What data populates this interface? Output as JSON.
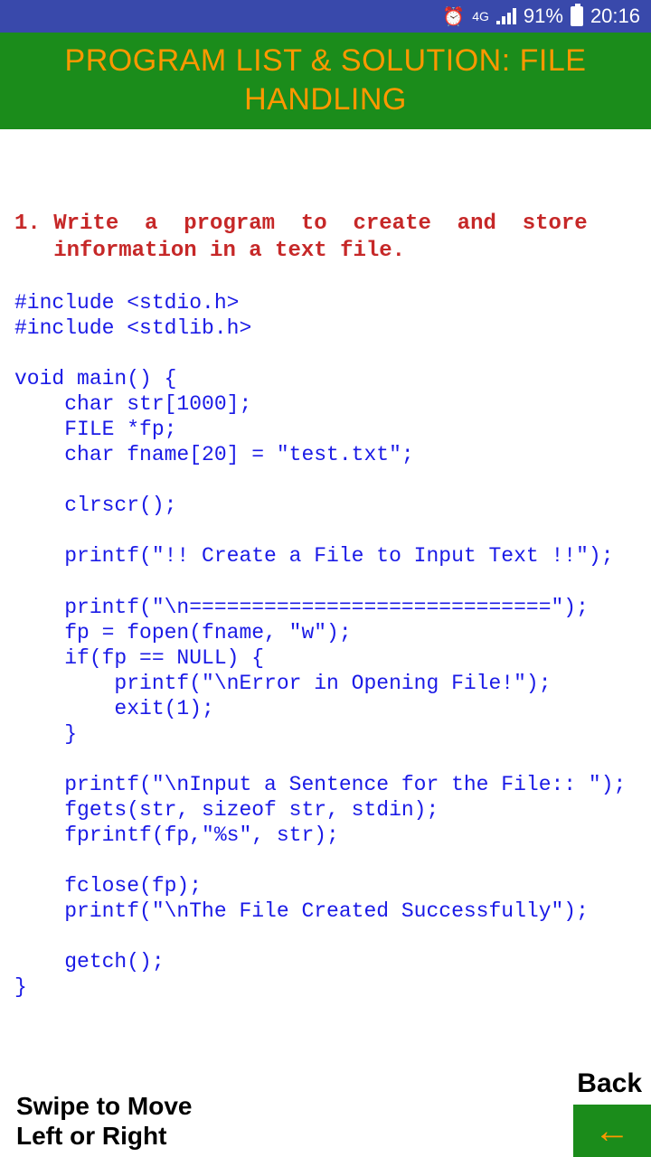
{
  "status": {
    "network": "4G",
    "battery_pct": "91%",
    "time": "20:16"
  },
  "header": {
    "title": "PROGRAM LIST & SOLUTION: FILE HANDLING"
  },
  "content": {
    "question": "1. Write  a  program  to  create  and  store\n   information in a text file.",
    "code": "#include <stdio.h>\n#include <stdlib.h>\n\nvoid main() {\n    char str[1000];\n    FILE *fp;\n    char fname[20] = \"test.txt\";\n\n    clrscr();\n\n    printf(\"!! Create a File to Input Text !!\");\n\n    printf(\"\\n=============================\");\n    fp = fopen(fname, \"w\");\n    if(fp == NULL) {\n        printf(\"\\nError in Opening File!\");\n        exit(1);\n    }\n\n    printf(\"\\nInput a Sentence for the File:: \");\n    fgets(str, sizeof str, stdin);\n    fprintf(fp,\"%s\", str);\n\n    fclose(fp);\n    printf(\"\\nThe File Created Successfully\");\n\n    getch();\n}"
  },
  "footer": {
    "swipe_hint": "Swipe to Move\n  Left or Right",
    "back_label": "Back",
    "back_arrow": "←"
  }
}
